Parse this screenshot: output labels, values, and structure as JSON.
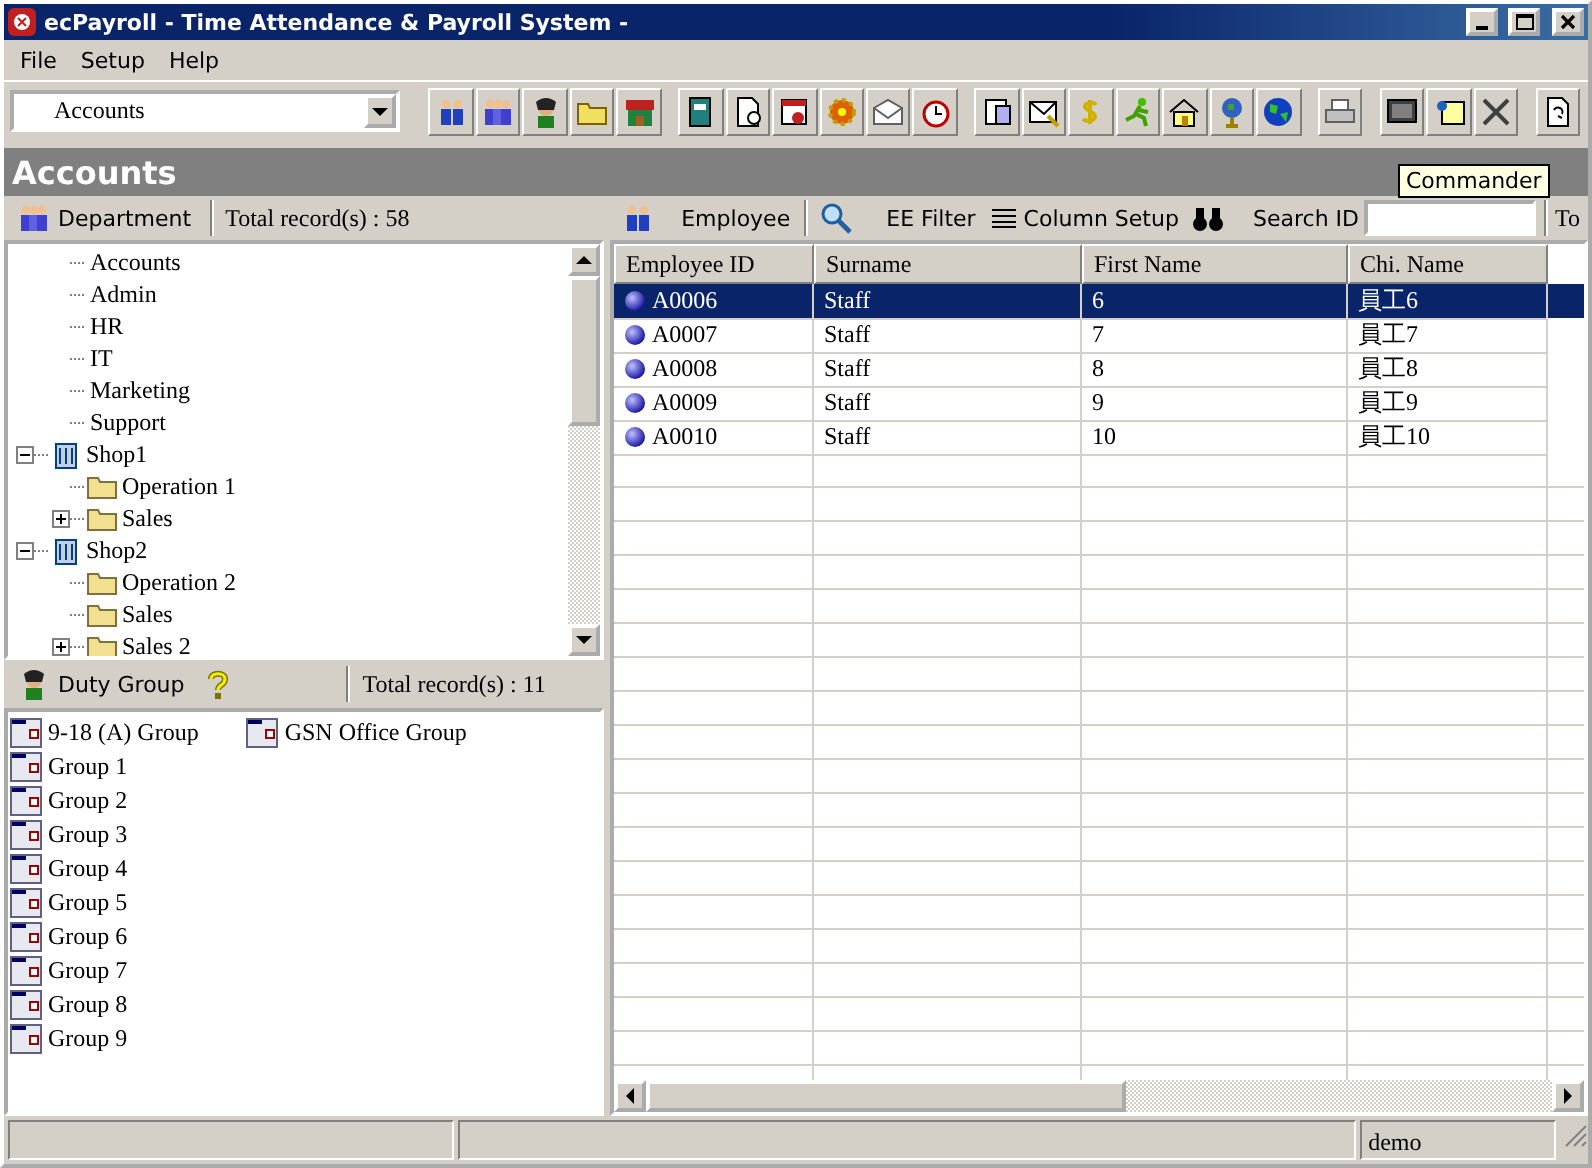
{
  "window": {
    "title": "ecPayroll - Time Attendance & Payroll System -"
  },
  "menu": [
    "File",
    "Setup",
    "Help"
  ],
  "toolbar": {
    "combo_value": "Accounts",
    "tooltip": "Commander"
  },
  "page_title": "Accounts",
  "department": {
    "label": "Department",
    "total": "Total record(s) : 58"
  },
  "tree": {
    "upper_items": [
      {
        "label": "Accounts"
      },
      {
        "label": "Admin"
      },
      {
        "label": "HR"
      },
      {
        "label": "IT"
      },
      {
        "label": "Marketing"
      },
      {
        "label": "Support"
      }
    ],
    "nodes": [
      {
        "kind": "shop",
        "label": "Shop1",
        "expanded": true,
        "children": [
          {
            "kind": "folder",
            "label": "Operation 1"
          },
          {
            "kind": "folder",
            "label": "Sales",
            "expanded": false
          }
        ]
      },
      {
        "kind": "shop",
        "label": "Shop2",
        "expanded": true,
        "children": [
          {
            "kind": "folder",
            "label": "Operation 2"
          },
          {
            "kind": "folder",
            "label": "Sales"
          },
          {
            "kind": "folder",
            "label": "Sales 2",
            "expanded": false
          }
        ]
      }
    ]
  },
  "duty_group": {
    "label": "Duty Group",
    "total": "Total record(s) : 11",
    "groups": [
      "9-18 (A) Group",
      "Group 1",
      "Group 2",
      "Group 3",
      "Group 4",
      "Group 5",
      "Group 6",
      "Group 7",
      "Group 8",
      "Group 9",
      "GSN Office Group"
    ]
  },
  "employee_toolbar": {
    "employee": "Employee",
    "filter": "EE Filter",
    "column_setup": "Column Setup",
    "search_label": "Search ID",
    "to_label": "To"
  },
  "table": {
    "columns": [
      "Employee ID",
      "Surname",
      "First Name",
      "Chi. Name"
    ],
    "rows": [
      {
        "selected": true,
        "cells": [
          "A0006",
          "Staff",
          "6",
          "員工6"
        ]
      },
      {
        "selected": false,
        "cells": [
          "A0007",
          "Staff",
          "7",
          "員工7"
        ]
      },
      {
        "selected": false,
        "cells": [
          "A0008",
          "Staff",
          "8",
          "員工8"
        ]
      },
      {
        "selected": false,
        "cells": [
          "A0009",
          "Staff",
          "9",
          "員工9"
        ]
      },
      {
        "selected": false,
        "cells": [
          "A0010",
          "Staff",
          "10",
          "員工10"
        ]
      }
    ]
  },
  "status_bar": {
    "user": "demo"
  }
}
